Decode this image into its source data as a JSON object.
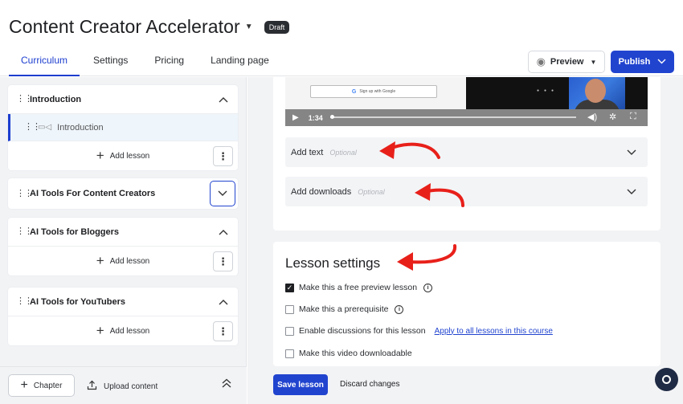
{
  "header": {
    "course_title": "Content Creator Accelerator",
    "status_badge": "Draft",
    "tabs": [
      {
        "label": "Curriculum",
        "active": true
      },
      {
        "label": "Settings"
      },
      {
        "label": "Pricing"
      },
      {
        "label": "Landing page"
      }
    ],
    "preview_label": "Preview",
    "publish_label": "Publish"
  },
  "sidebar": {
    "chapters": [
      {
        "title": "Introduction",
        "expanded": true,
        "lessons": [
          "Introduction"
        ],
        "add_label": "Add lesson"
      },
      {
        "title": "AI Tools For Content Creators",
        "expanded": false
      },
      {
        "title": "AI Tools for Bloggers",
        "expanded": true,
        "add_label": "Add lesson"
      },
      {
        "title": "AI Tools for YouTubers",
        "expanded": true,
        "add_label": "Add lesson"
      }
    ],
    "footer": {
      "chapter_label": "Chapter",
      "upload_label": "Upload content"
    }
  },
  "video": {
    "signup_text": "Sign up with Google",
    "time": "1:34",
    "progress": 0.05
  },
  "accordions": [
    {
      "label": "Add text",
      "hint": "Optional"
    },
    {
      "label": "Add downloads",
      "hint": "Optional"
    }
  ],
  "lesson_settings": {
    "title": "Lesson settings",
    "options": [
      {
        "label": "Make this a free preview lesson",
        "checked": true,
        "info": true
      },
      {
        "label": "Make this a prerequisite",
        "checked": false,
        "info": true
      },
      {
        "label": "Enable discussions for this lesson",
        "checked": false,
        "link": "Apply to all lessons in this course"
      },
      {
        "label": "Make this video downloadable",
        "checked": false
      }
    ]
  },
  "actions": {
    "save_label": "Save lesson",
    "discard_label": "Discard changes"
  },
  "colors": {
    "accent": "#2144cf",
    "annotation": "#e8201a"
  }
}
